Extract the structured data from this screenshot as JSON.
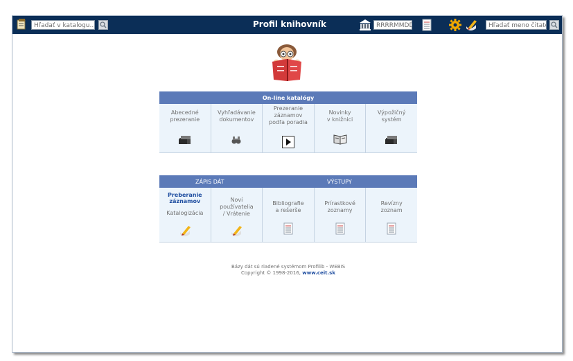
{
  "topbar": {
    "title": "Profil knihovník",
    "catalog_search_placeholder": "Hľadať v katalogu...",
    "date_placeholder": "RRRRMMDD",
    "reader_search_placeholder": "Hľadať meno čitateľa"
  },
  "catalogs": {
    "header": "On-line katalógy",
    "items": [
      {
        "label": "Abecedné\nprezeranie",
        "icon": "books-icon"
      },
      {
        "label": "Vyhľadávanie\ndokumentov",
        "icon": "binoculars-icon"
      },
      {
        "label": "Prezeranie\nzáznamov\npodľa poradia",
        "icon": "play-icon"
      },
      {
        "label": "Novinky\nv knižnici",
        "icon": "open-book-icon"
      },
      {
        "label": "Výpožičný\nsystém",
        "icon": "books-icon"
      }
    ]
  },
  "tasks": {
    "header_left": "ZÁPIS DÁT",
    "header_right": "VÝSTUPY",
    "items": [
      {
        "label_bold": "Preberanie\nzáznamov",
        "label": "Katalogizácia",
        "icon": "pencil-icon"
      },
      {
        "label": "Noví\npoužívatelia\n/ Vrátenie",
        "icon": "pencil-icon"
      },
      {
        "label": "Bibliografie\na rešerše",
        "icon": "document-icon"
      },
      {
        "label": "Prírastkové\nzoznamy",
        "icon": "document-icon"
      },
      {
        "label": "Revízny\nzoznam",
        "icon": "document-icon"
      }
    ]
  },
  "footer": {
    "line1": "Bázy dát sú riadené systémom Profilib - WEBIS",
    "line2": "Copyright © 1998-2016,",
    "url": "www.ceit.sk"
  },
  "colors": {
    "topbar": "#0b2e57",
    "panel_header": "#5b7ab8",
    "panel_bg": "#ecf4fb",
    "link": "#1f4ea0"
  }
}
